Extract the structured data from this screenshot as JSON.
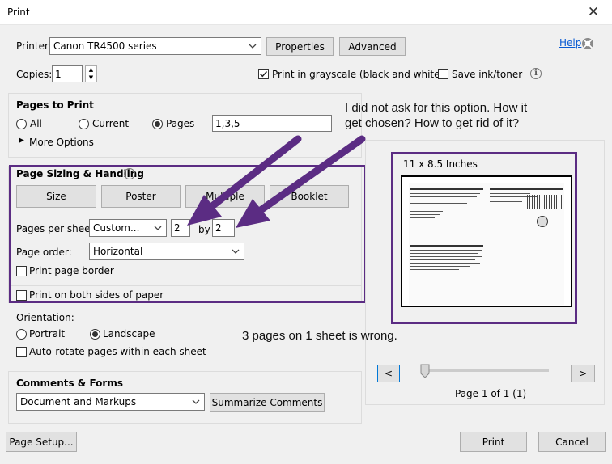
{
  "window": {
    "title": "Print"
  },
  "printer": {
    "label": "Printer:",
    "selected": "Canon TR4500 series",
    "properties_label": "Properties",
    "advanced_label": "Advanced",
    "help_label": "Help",
    "copies_label": "Copies:",
    "copies_value": "1",
    "grayscale_label": "Print in grayscale (black and white)",
    "grayscale_checked": true,
    "save_ink_label": "Save ink/toner",
    "save_ink_checked": false
  },
  "pages_to_print": {
    "heading": "Pages to Print",
    "all_label": "All",
    "current_label": "Current",
    "pages_label": "Pages",
    "pages_value": "1,3,5",
    "selected": "Pages",
    "more_options_label": "More Options"
  },
  "sizing": {
    "heading": "Page Sizing & Handling",
    "tabs": [
      {
        "label": "Size"
      },
      {
        "label": "Poster"
      },
      {
        "label": "Multiple"
      },
      {
        "label": "Booklet"
      }
    ],
    "pages_per_sheet_label": "Pages per sheet:",
    "pages_per_sheet_value": "Custom...",
    "cols_value": "2",
    "by_label": "by",
    "rows_value": "2",
    "page_order_label": "Page order:",
    "page_order_value": "Horizontal",
    "print_border_label": "Print page border",
    "both_sides_label": "Print on both sides of paper"
  },
  "orientation": {
    "heading": "Orientation:",
    "portrait_label": "Portrait",
    "landscape_label": "Landscape",
    "selected": "Landscape",
    "autorotate_label": "Auto-rotate pages within each sheet"
  },
  "comments": {
    "heading": "Comments & Forms",
    "selected": "Document and Markups",
    "summarize_label": "Summarize Comments"
  },
  "preview": {
    "paper_size": "11 x 8.5 Inches",
    "prev_label": "<",
    "next_label": ">",
    "page_info": "Page 1 of 1 (1)",
    "slider_fraction": 0
  },
  "footer": {
    "page_setup_label": "Page Setup...",
    "print_label": "Print",
    "cancel_label": "Cancel"
  },
  "annotations": {
    "note_top": "I did not ask for this option. How it get chosen? How to get rid of it?",
    "note_bottom": "3 pages on 1 sheet is wrong."
  },
  "colors": {
    "annotation_purple": "#5b2c83",
    "help_link": "#0a5bd3",
    "button_gray": "#e1e1e1"
  }
}
